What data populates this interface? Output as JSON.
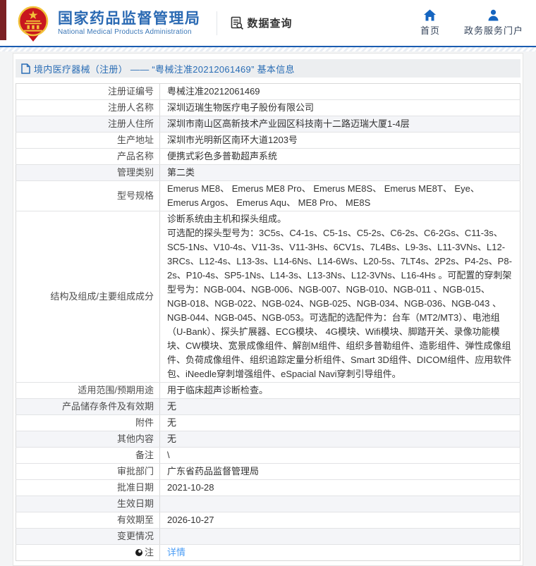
{
  "colors": {
    "accent_blue": "#2b6ab3",
    "header_rule_blue": "#1a5cb0",
    "left_strip_maroon": "#7b2124",
    "breadcrumb_bg": "#eceef0",
    "link_blue": "#4a9cf5",
    "shaded_row": "#f4f5f8",
    "emblem_red": "#c8171e",
    "emblem_gold": "#f2c23a"
  },
  "header": {
    "emblem": "china-national-emblem",
    "title": "国家药品监督管理局",
    "subtitle": "National Medical Products Administration",
    "data_query_label": "数据查询",
    "nav": [
      {
        "label": "首页",
        "icon": "home-icon"
      },
      {
        "label": "政务服务门户",
        "icon": "user-icon"
      }
    ]
  },
  "breadcrumb": {
    "text": "境内医疗器械（注册） ——  “粤械注准20212061469”  基本信息"
  },
  "table": {
    "rows": [
      {
        "label": "注册证编号",
        "value": "粤械注准20212061469"
      },
      {
        "label": "注册人名称",
        "value": "深圳迈瑞生物医疗电子股份有限公司"
      },
      {
        "label": "注册人住所",
        "value": "深圳市南山区高新技术产业园区科技南十二路迈瑞大厦1-4层",
        "shaded": true
      },
      {
        "label": "生产地址",
        "value": "深圳市光明新区南环大道1203号"
      },
      {
        "label": "产品名称",
        "value": "便携式彩色多普勒超声系统"
      },
      {
        "label": "管理类别",
        "value": "第二类",
        "shaded": true
      },
      {
        "label": "型号规格",
        "value": "Emerus ME8、 Emerus ME8 Pro、 Emerus ME8S、 Emerus ME8T、 Eye、 Emerus Argos、 Emerus Aqu、 ME8 Pro、 ME8S"
      },
      {
        "label": "结构及组成/主要组成成分",
        "value": "诊断系统由主机和探头组成。\n可选配的探头型号为：3C5s、C4-1s、C5-1s、C5-2s、C6-2s、C6-2Gs、C11-3s、SC5-1Ns、V10-4s、V11-3s、V11-3Hs、6CV1s、7L4Bs、L9-3s、L11-3VNs、L12-3RCs、L12-4s、L13-3s、L14-6Ns、L14-6Ws、L20-5s、7LT4s、2P2s、P4-2s、P8-2s、P10-4s、SP5-1Ns、L14-3s、L13-3Ns、L12-3VNs、L16-4Hs 。可配置的穿刺架型号为：NGB-004、NGB-006、NGB-007、NGB-010、NGB-011 、NGB-015、NGB-018、NGB-022、NGB-024、NGB-025、NGB-034、NGB-036、NGB-043 、NGB-044、NGB-045、NGB-053。可选配的选配件为：台车（MT2/MT3）、电池组（U-Bank）、探头扩展器、ECG模块、 4G模块、Wifi模块、脚踏开关、录像功能模块、CW模块、宽景成像组件、解剖M组件、组织多普勒组件、造影组件、弹性成像组件、负荷成像组件、组织追踪定量分析组件、Smart 3D组件、DICOM组件、应用软件包、iNeedle穿刺增强组件、eSpacial Navi穿刺引导组件。"
      },
      {
        "label": "适用范围/预期用途",
        "value": "用于临床超声诊断检查。"
      },
      {
        "label": "产品储存条件及有效期",
        "value": "无",
        "shaded": true
      },
      {
        "label": "附件",
        "value": "无"
      },
      {
        "label": "其他内容",
        "value": "无",
        "shaded": true
      },
      {
        "label": "备注",
        "value": "\\"
      },
      {
        "label": "审批部门",
        "value": "广东省药品监督管理局"
      },
      {
        "label": "批准日期",
        "value": "2021-10-28"
      },
      {
        "label": "生效日期",
        "value": "",
        "shaded": true
      },
      {
        "label": "有效期至",
        "value": "2026-10-27"
      },
      {
        "label": "变更情况",
        "value": "",
        "shaded": true
      },
      {
        "label": "注",
        "value": "详情",
        "link": true,
        "note_icon": true
      }
    ]
  }
}
